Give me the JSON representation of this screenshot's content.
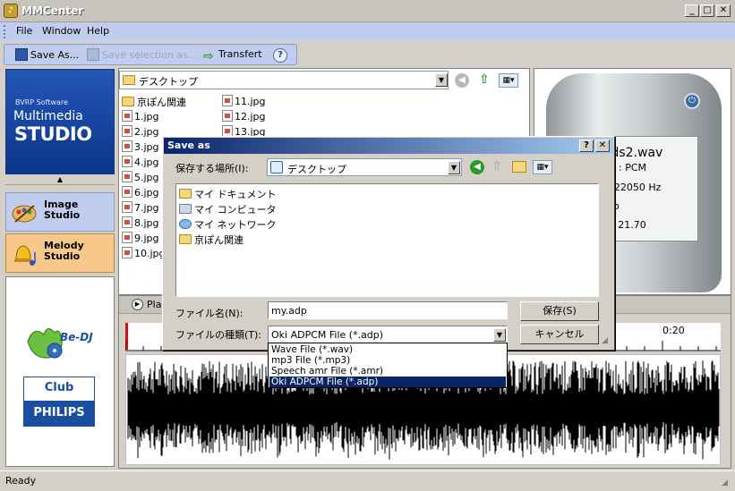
{
  "window": {
    "title": "MMCenter",
    "buttons": [
      "_",
      "□",
      "✕"
    ]
  },
  "menu": [
    "File",
    "Window",
    "Help"
  ],
  "toolbar": {
    "save_as": "Save As...",
    "save_selection": "Save selection as...",
    "transfert": "Transfert",
    "help": "?"
  },
  "sidebar": {
    "logo": {
      "line1": "BVRP Software",
      "line2": "Multimedia",
      "line3": "STUDIO"
    },
    "collapse": "▲",
    "items": [
      {
        "line1": "Image",
        "line2": "Studio"
      },
      {
        "line1": "Melody",
        "line2": "Studio"
      }
    ],
    "brands": {
      "bedj": "Be-DJ",
      "club": "Club",
      "philips": "PHILIPS"
    }
  },
  "browser": {
    "path": "デスクトップ",
    "col1": [
      "京ぽん関連",
      "1.jpg",
      "2.jpg",
      "3.jpg",
      "4.jpg",
      "5.jpg",
      "6.jpg",
      "7.jpg",
      "8.jpg",
      "9.jpg",
      "10.jpg"
    ],
    "col2": [
      "11.jpg",
      "12.jpg",
      "13.jpg"
    ]
  },
  "device": {
    "filename": "ends2.wav",
    "line2": "sion : PCM",
    "line3": "y: 22050 Hz",
    "line4": "o",
    "line5": ": 21.70"
  },
  "player": {
    "label": "Pla",
    "time_mark": "0:20"
  },
  "status": "Ready",
  "dialog": {
    "title": "Save as",
    "help": "?",
    "close": "✕",
    "lookin_label": "保存する場所(I):",
    "lookin_value": "デスクトップ",
    "items": [
      "マイ ドキュメント",
      "マイ コンピュータ",
      "マイ ネットワーク",
      "京ぽん関連"
    ],
    "filename_label": "ファイル名(N):",
    "filename_value": "my.adp",
    "filetype_label": "ファイルの種類(T):",
    "filetype_value": "Oki ADPCM File (*.adp)",
    "save_button": "保存(S)",
    "cancel_button": "キャンセル",
    "filetype_options": [
      "Wave File (*.wav)",
      "mp3 File (*.mp3)",
      "Speech amr File (*.amr)",
      "Oki ADPCM File (*.adp)"
    ],
    "selected_option_index": 3
  },
  "colors": {
    "titlebar_active": "#0a246a",
    "menu_bg": "#c0cdef",
    "studio_active": "#f7c88a",
    "logo_blue": "#1f4fae"
  }
}
